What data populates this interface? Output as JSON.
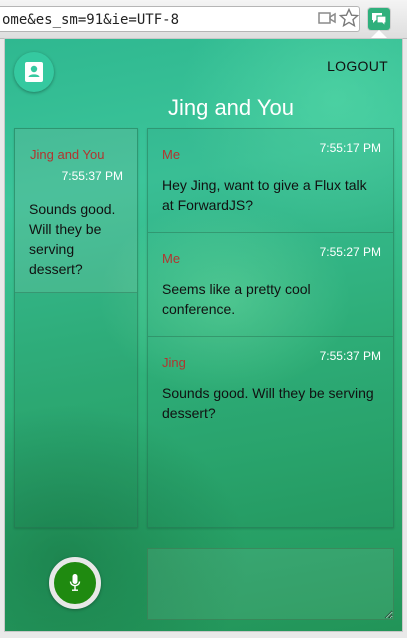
{
  "browser": {
    "url": "ome&es_sm=91&ie=UTF-8",
    "icons": [
      "camera-icon",
      "star-icon",
      "chat-extension-icon"
    ]
  },
  "header": {
    "contacts_icon": "contacts-icon",
    "logout_label": "LOGOUT",
    "thread_title": "Jing and You"
  },
  "threads": [
    {
      "name": "Jing and You",
      "time": "7:55:37 PM",
      "last_message": "Sounds good. Will they be serving dessert?"
    }
  ],
  "messages": [
    {
      "author": "Me",
      "time": "7:55:17 PM",
      "text": "Hey Jing, want to give a Flux talk at ForwardJS?"
    },
    {
      "author": "Me",
      "time": "7:55:27 PM",
      "text": "Seems like a pretty cool conference."
    },
    {
      "author": "Jing",
      "time": "7:55:37 PM",
      "text": "Sounds good. Will they be serving dessert?"
    }
  ],
  "composer": {
    "value": "",
    "mic_icon": "microphone-icon"
  },
  "colors": {
    "accent": "#35c9a0",
    "author": "#b3342f",
    "mic": "#1f8a10"
  }
}
